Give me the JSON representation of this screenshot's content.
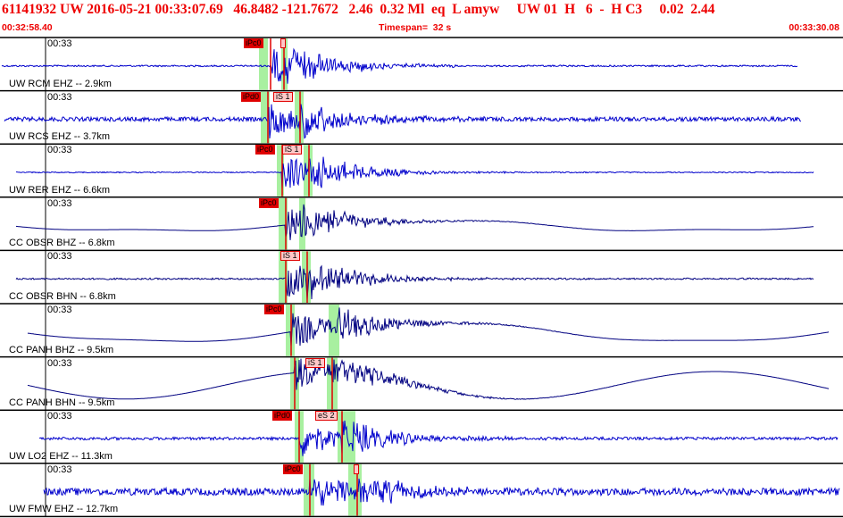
{
  "header": {
    "title": "61141932 UW 2016-05-21 00:33:07.69   46.8482 -121.7672   2.46  0.32 Ml  eq  L amyw     UW 01  H   6  -  H C3     0.02  2.44",
    "time_start": "00:32:58.40",
    "timespan": "Timespan=  32 s",
    "time_end": "00:33:30.08"
  },
  "minute_label": "00:33",
  "colors": {
    "header_text": "#ee0000",
    "trace": "#0000cc",
    "trace_dark": "#000080",
    "pick_box": "#e00000",
    "pick_window": "#a8f0a0",
    "separator": "#000000"
  },
  "traces": [
    {
      "label": "UW RCM EHZ -- 2.9km",
      "picks": [
        {
          "text": "iPc0",
          "kind": "p"
        },
        {
          "text": "",
          "kind": "s"
        }
      ]
    },
    {
      "label": "UW RCS EHZ -- 3.7km",
      "picks": [
        {
          "text": "iPd0",
          "kind": "p"
        },
        {
          "text": "iS 1",
          "kind": "s"
        }
      ]
    },
    {
      "label": "UW RER EHZ -- 6.6km",
      "picks": [
        {
          "text": "iPc0",
          "kind": "p"
        },
        {
          "text": "iS 1",
          "kind": "s"
        }
      ]
    },
    {
      "label": "CC OBSR BHZ -- 6.8km",
      "picks": [
        {
          "text": "iPc0",
          "kind": "p"
        }
      ]
    },
    {
      "label": "CC OBSR BHN -- 6.8km",
      "picks": [
        {
          "text": "iS 1",
          "kind": "s"
        }
      ]
    },
    {
      "label": "CC PANH BHZ -- 9.5km",
      "picks": [
        {
          "text": "iPc0",
          "kind": "p"
        }
      ]
    },
    {
      "label": "CC PANH BHN -- 9.5km",
      "picks": [
        {
          "text": "iS 1",
          "kind": "s"
        }
      ]
    },
    {
      "label": "UW LO2 EHZ -- 11.3km",
      "picks": [
        {
          "text": "iPd0",
          "kind": "p"
        },
        {
          "text": "eS 2",
          "kind": "s"
        }
      ]
    },
    {
      "label": "UW FMW EHZ -- 12.7km",
      "picks": [
        {
          "text": "iPc0",
          "kind": "p"
        },
        {
          "text": "",
          "kind": "s"
        }
      ]
    }
  ]
}
